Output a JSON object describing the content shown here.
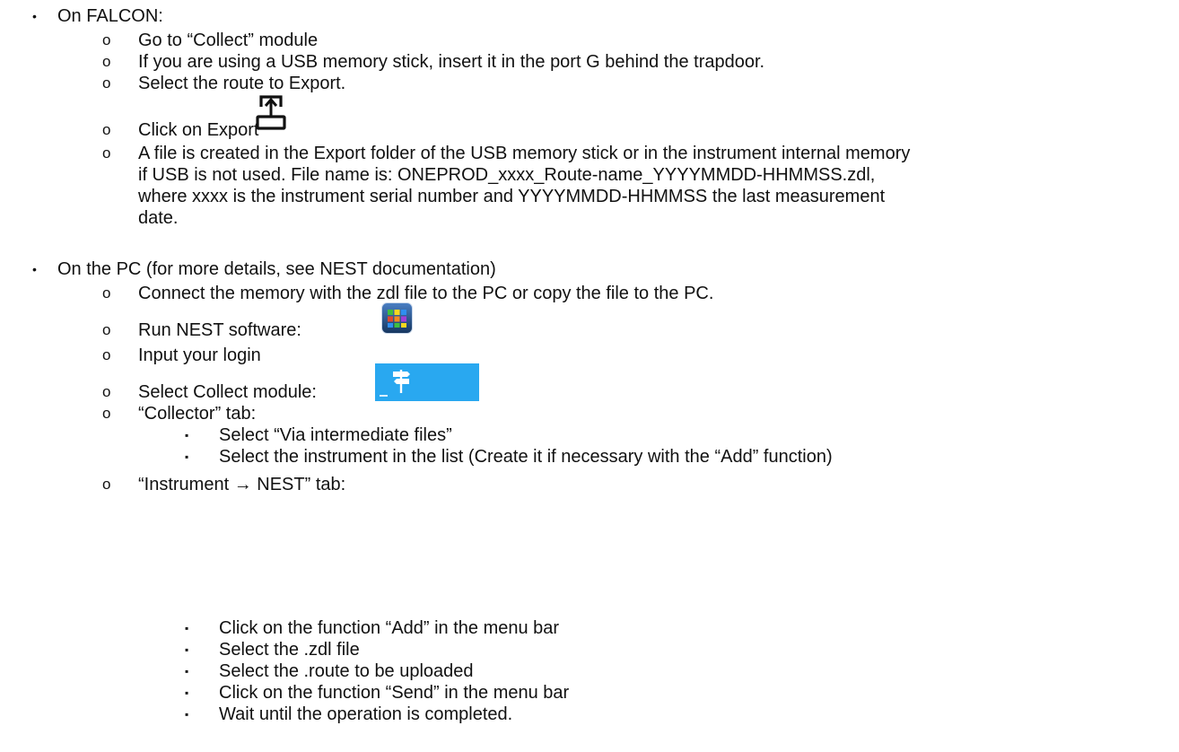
{
  "falcon": {
    "heading": "On FALCON:",
    "steps": [
      "Go to “Collect” module",
      "If you are using a USB memory stick, insert it in the port G behind the trapdoor.",
      "Select the route to Export.",
      "Click on Export",
      "A file is created in the Export folder of the USB memory stick or in the instrument internal memory",
      "if USB is not used. File name is: ONEPROD_xxxx_Route-name_YYYYMMDD-HHMMSS.zdl,",
      "where xxxx is the instrument serial number and YYYYMMDD-HHMMSS the last measurement",
      "date."
    ]
  },
  "pc": {
    "heading": "On the PC (for more details, see NEST documentation)",
    "steps": [
      "Connect the memory with the zdl file to the PC or copy the file to the PC.",
      "Run NEST software:",
      "Input your login",
      "Select Collect module:",
      "“Collector” tab:",
      "“Instrument → NEST” tab:"
    ],
    "collector_substeps": [
      "Select “Via intermediate files”",
      "Select the instrument in the list (Create it if necessary with the “Add” function)"
    ],
    "instrument_substeps": [
      "Click on the function “Add” in the menu bar",
      "Select the .zdl file",
      "Select the .route to be uploaded",
      "Click on the function “Send” in the menu bar",
      "Wait until the operation is completed."
    ]
  },
  "bullets": {
    "level1": "•",
    "level2": "o",
    "level3": "▪"
  },
  "icons": {
    "export": "export-icon",
    "nest_app": "nest-app-icon",
    "collect_module": "collect-module-icon"
  },
  "colors": {
    "nest_tiles": [
      "#3fbf3f",
      "#f5d81f",
      "#2f8ff0",
      "#e0492f",
      "#f58a1f",
      "#a03fd8"
    ],
    "collect_bg": "#29a8f0"
  }
}
